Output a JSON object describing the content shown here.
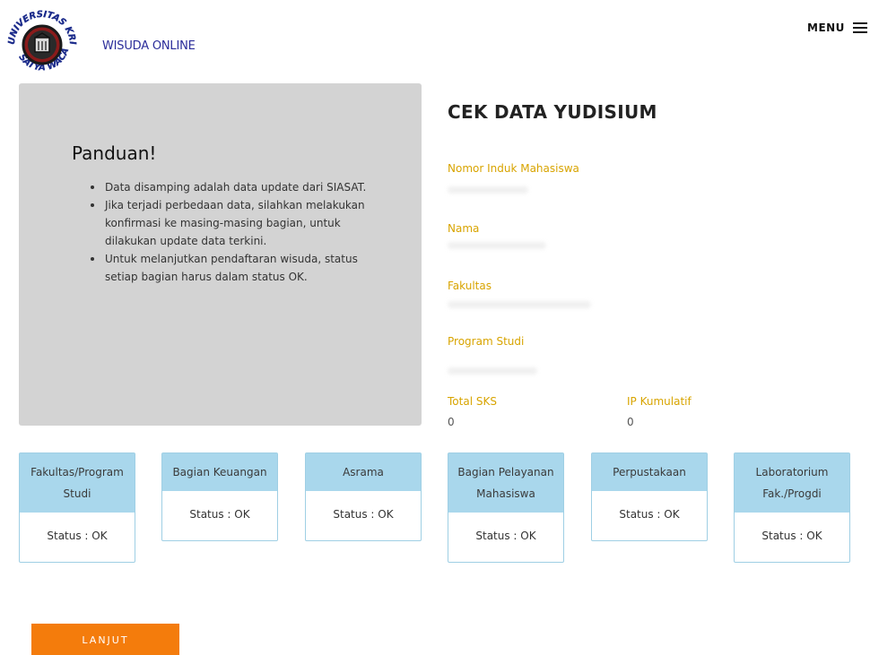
{
  "header": {
    "brand": "WISUDA ONLINE",
    "menu_label": "MENU",
    "logo_text_top": "UNIVERSITAS KRISTEN",
    "logo_text_bottom": "SATYA WACANA"
  },
  "guide": {
    "title": "Panduan!",
    "items": [
      "Data disamping adalah data update dari SIASAT.",
      "Jika terjadi perbedaan data, silahkan melakukan konfirmasi ke masing-masing bagian, untuk dilakukan update data terkini.",
      "Untuk melanjutkan pendaftaran wisuda, status setiap bagian harus dalam status OK."
    ]
  },
  "yudisium": {
    "title": "CEK DATA YUDISIUM",
    "nim_label": "Nomor Induk Mahasiswa",
    "nama_label": "Nama",
    "fakultas_label": "Fakultas",
    "prodi_label": "Program Studi",
    "sks_label": "Total SKS",
    "sks_value": "0",
    "ipk_label": "IP Kumulatif",
    "ipk_value": "0"
  },
  "status_cards": [
    {
      "title": "Fakultas/Program Studi",
      "status": "Status : OK"
    },
    {
      "title": "Bagian Keuangan",
      "status": "Status : OK"
    },
    {
      "title": "Asrama",
      "status": "Status : OK"
    },
    {
      "title": "Bagian Pelayanan Mahasiswa",
      "status": "Status : OK"
    },
    {
      "title": "Perpustakaan",
      "status": "Status : OK"
    },
    {
      "title": "Laboratorium Fak./Progdi",
      "status": "Status : OK"
    }
  ],
  "actions": {
    "continue_label": "LANJUT"
  },
  "colors": {
    "accent_orange": "#f47c0c",
    "label_gold": "#d8a400",
    "card_header_blue": "#a9d7ec",
    "panel_gray": "#d3d3d3",
    "brand_blue": "#2b2d9a"
  }
}
